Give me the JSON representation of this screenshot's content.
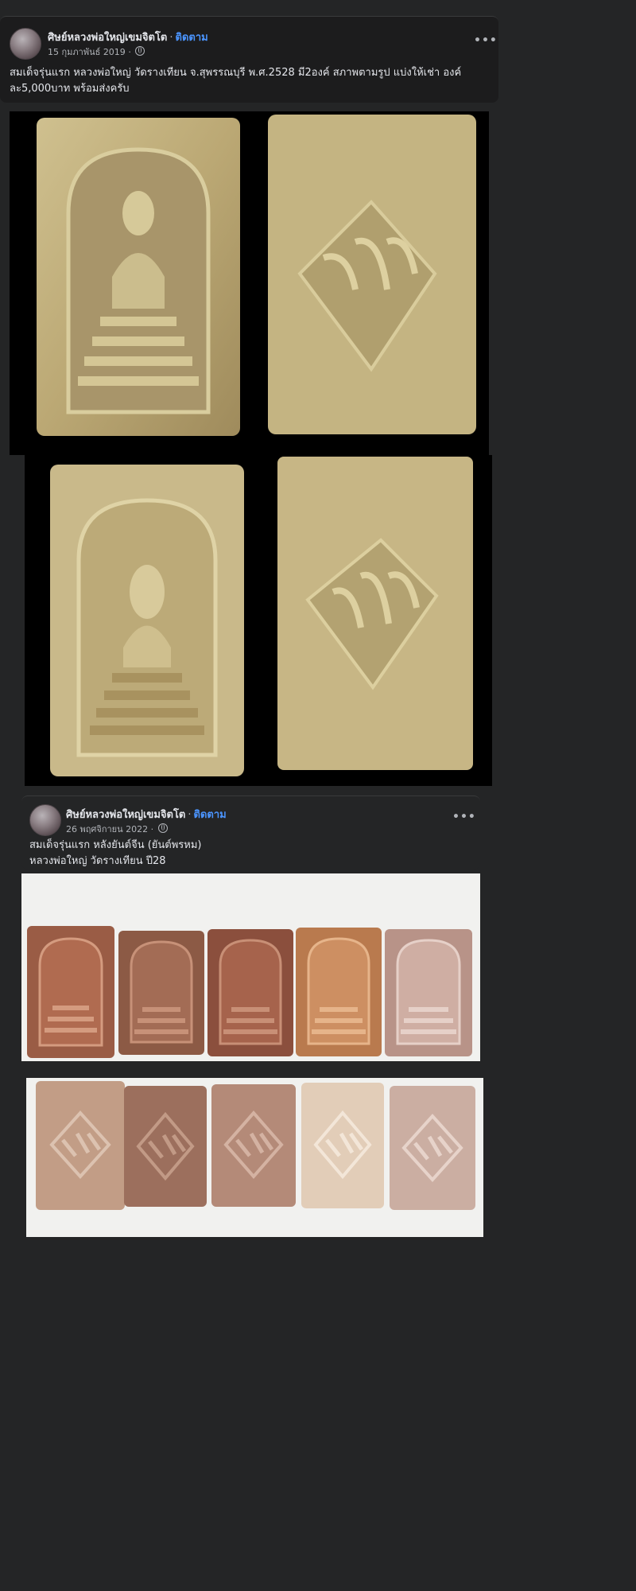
{
  "posts": [
    {
      "author": "ศิษย์หลวงพ่อใหญ่เขมจิตโต",
      "separator": "·",
      "follow_label": "ติดตาม",
      "date": "15 กุมภาพันธ์ 2019",
      "date_sep": "·",
      "more_label": "•••",
      "text_line1": "สมเด็จรุ่นแรก หลวงพ่อใหญ่ วัดรางเทียน จ.สุพรรณบุรี พ.ศ.2528 มี2องค์ สภาพตามรูป แบ่งให้เช่า องค์",
      "text_line2": "ละ5,000บาท พร้อมส่งครับ"
    },
    {
      "author": "ศิษย์หลวงพ่อใหญ่เขมจิตโต",
      "separator": "·",
      "follow_label": "ติดตาม",
      "date": "26 พฤศจิกายน 2022",
      "date_sep": "·",
      "more_label": "•••",
      "text_line1": "สมเด็จรุ่นแรก หลังยันต์จีน (ยันต์พรหม)",
      "text_line2": "หลวงพ่อใหญ่ วัดรางเทียน ปี28"
    }
  ],
  "icons": {
    "globe": "globe-icon",
    "more": "more-options-icon",
    "avatar": "profile-avatar"
  },
  "colors": {
    "background": "#242526",
    "follow_link": "#4b95ff",
    "secondary_text": "#b0b3b8"
  }
}
